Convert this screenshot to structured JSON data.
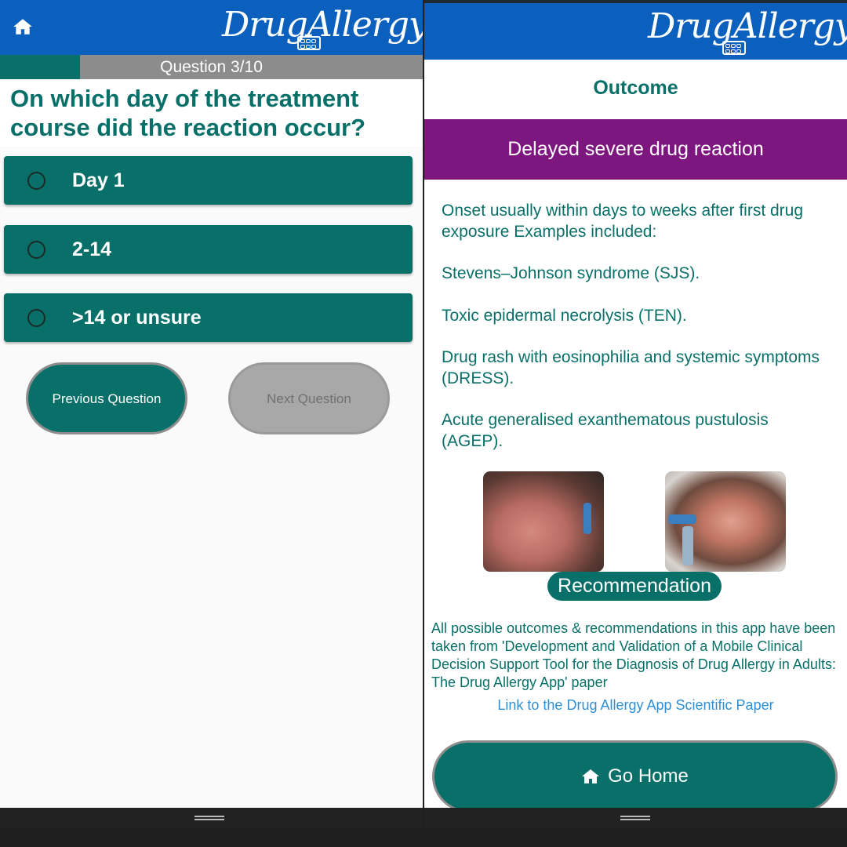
{
  "app": {
    "brand": "DrugAllergy",
    "colors": {
      "appbar": "#0b5fbd",
      "teal": "#097069",
      "purple": "#7e1680",
      "link": "#2f8fd6"
    }
  },
  "quiz": {
    "home_icon": "home-icon",
    "progress_label": "Question 3/10",
    "progress_fraction": 0.3,
    "question": "On which day of the treatment course did the reaction occur?",
    "options": [
      {
        "label": "Day 1",
        "selected": false
      },
      {
        "label": "2-14",
        "selected": false
      },
      {
        "label": ">14 or unsure",
        "selected": false
      }
    ],
    "prev_label": "Previous Question",
    "next_label": "Next Question"
  },
  "outcome": {
    "title": "Outcome",
    "banner": "Delayed severe drug reaction",
    "paragraphs": [
      "Onset usually within days to weeks after first drug exposure Examples included:",
      "Stevens–Johnson syndrome (SJS).",
      "Toxic epidermal necrolysis (TEN).",
      "Drug rash with eosinophilia and systemic symptoms (DRESS).",
      "Acute generalised exanthematous pustulosis (AGEP)."
    ],
    "recommendation_label": "Recommendation",
    "note": "All possible outcomes & recommendations in this app have been taken from 'Development and Validation of a Mobile Clinical Decision Support Tool for the Diagnosis of Drug Allergy in Adults: The Drug Allergy App' paper",
    "link": "Link to the Drug Allergy App Scientific Paper",
    "go_home_label": "Go Home"
  }
}
